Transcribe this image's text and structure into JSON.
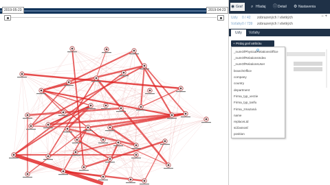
{
  "timeline": {
    "start_date": "2019-05-23",
    "end_date": "2019-04-23"
  },
  "panel": {
    "tabs": [
      {
        "label": "Graf",
        "icon": "graph-icon",
        "active": true
      },
      {
        "label": "Hľadaj",
        "icon": "search-icon",
        "active": false
      },
      {
        "label": "Detail",
        "icon": "info-icon",
        "active": false
      },
      {
        "label": "Nastavenia",
        "icon": "gear-icon",
        "active": false
      }
    ],
    "stats": [
      {
        "key": "Uzly",
        "count": "0 / 42",
        "desc": "zobrazených / všetkých"
      },
      {
        "key": "Vzťahy",
        "count": "0 / 739",
        "desc": "zobrazených / všetkých"
      }
    ],
    "stat_icons": [
      "minus-icon",
      "plus-icon"
    ],
    "subtabs": [
      {
        "label": "Uzly",
        "active": true
      },
      {
        "label": "Vzťahy",
        "active": false
      }
    ],
    "add_button": "+ Pridaj graf atribútu",
    "dropdown": [
      "_numOfPhysicalRelationsOffice",
      "_numOfRelationsIndex",
      "_numOfRelationsUser",
      "branchOffice",
      "company",
      "country",
      "department",
      "Firma_typ_verzie",
      "Firma_typ_tarifu",
      "Firma_zmazaná",
      "name",
      "replaceLtd",
      "súčasnosť",
      "position"
    ]
  }
}
